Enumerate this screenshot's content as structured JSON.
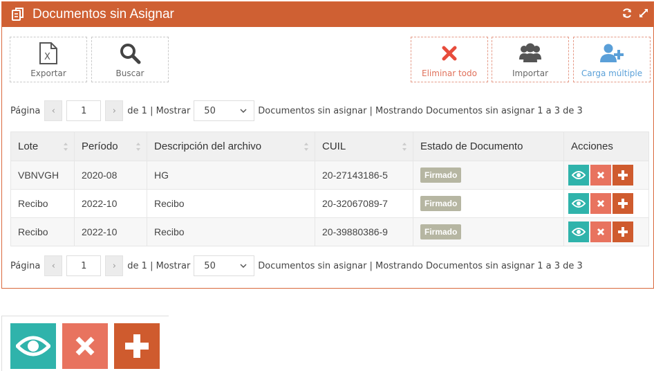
{
  "panel": {
    "title": "Documentos sin Asignar",
    "icons": {
      "title_icon": "documents-icon",
      "refresh": "refresh-icon",
      "expand": "expand-icon"
    }
  },
  "toolbar": {
    "exportar": "Exportar",
    "buscar": "Buscar",
    "eliminar_todo": "Eliminar todo",
    "importar": "Importar",
    "carga_multiple": "Carga múltiple"
  },
  "pager": {
    "pagina_label": "Página",
    "prev": "‹",
    "next": "›",
    "page_value": "1",
    "of_text": "de 1 | Mostrar",
    "page_size": "50",
    "summary": "Documentos sin asignar | Mostrando Documentos sin asignar 1 a 3 de 3"
  },
  "table": {
    "headers": [
      "Lote",
      "Período",
      "Descripción del archivo",
      "CUIL",
      "Estado de Documento",
      "Acciones"
    ],
    "rows": [
      {
        "lote": "VBNVGH",
        "periodo": "2020-08",
        "descripcion": "HG",
        "cuil": "20-27143186-5",
        "estado": "Firmado"
      },
      {
        "lote": "Recibo",
        "periodo": "2022-10",
        "descripcion": "Recibo",
        "cuil": "20-32067089-7",
        "estado": "Firmado"
      },
      {
        "lote": "Recibo",
        "periodo": "2022-10",
        "descripcion": "Recibo",
        "cuil": "20-39880386-9",
        "estado": "Firmado"
      }
    ]
  },
  "colors": {
    "header_bg": "#cf6033",
    "view": "#2fb3ab",
    "delete": "#e8735f",
    "add": "#cf5b2e",
    "badge": "#b6b6a2"
  }
}
